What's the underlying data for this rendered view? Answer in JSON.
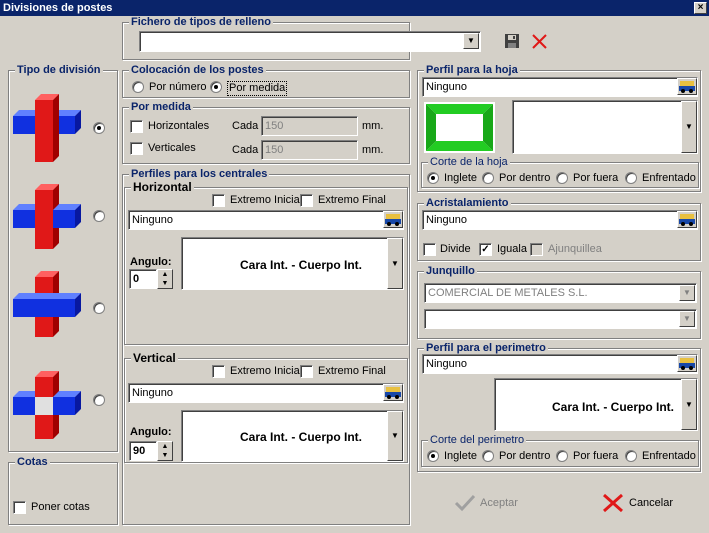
{
  "window": {
    "title": "Divisiones de postes",
    "close_glyph": "×"
  },
  "fichero": {
    "legend": "Fichero de tipos de relleno",
    "value": "",
    "save_icon": "floppy-disk-icon",
    "delete_icon": "red-x-icon"
  },
  "tipo_division": {
    "legend": "Tipo de división",
    "options": [
      {
        "icon": "cross-red-vertical-front-icon",
        "selected": true
      },
      {
        "icon": "cross-red-vertical-icon",
        "selected": false
      },
      {
        "icon": "cross-blue-horizontal-front-icon",
        "selected": false
      },
      {
        "icon": "cross-split-icon",
        "selected": false
      }
    ]
  },
  "cotas": {
    "legend": "Cotas",
    "poner_cotas": "Poner cotas",
    "checked": false
  },
  "colocacion": {
    "legend": "Colocación de los postes",
    "por_numero": "Por número",
    "por_medida": "Por medida",
    "selected": "por_medida"
  },
  "por_medida": {
    "legend": "Por medida",
    "horizontales": {
      "label": "Horizontales",
      "cada": "Cada",
      "value": "150",
      "unit": "mm.",
      "checked": false
    },
    "verticales": {
      "label": "Verticales",
      "cada": "Cada",
      "value": "150",
      "unit": "mm.",
      "checked": false
    }
  },
  "perfiles_centrales": {
    "legend": "Perfiles para los centrales",
    "horizontal": {
      "legend": "Horizontal",
      "extremo_inicial": "Extremo Inicial",
      "extremo_final": "Extremo Final",
      "perfil": "Ninguno",
      "angulo_label": "Angulo:",
      "angulo": "0",
      "cara": "Cara Int. - Cuerpo Int."
    },
    "vertical": {
      "legend": "Vertical",
      "extremo_inicial": "Extremo Inicial",
      "extremo_final": "Extremo Final",
      "perfil": "Ninguno",
      "angulo_label": "Angulo:",
      "angulo": "90",
      "cara": "Cara Int. - Cuerpo Int."
    }
  },
  "perfil_hoja": {
    "legend": "Perfil para la hoja",
    "value": "Ninguno",
    "corte": {
      "legend": "Corte de la hoja",
      "options": [
        "Inglete",
        "Por dentro",
        "Por fuera",
        "Enfrentado"
      ],
      "selected": 0
    }
  },
  "acristalamiento": {
    "legend": "Acristalamiento",
    "value": "Ninguno",
    "divide": "Divide",
    "iguala": "Iguala",
    "ajunquillea": "Ajunquillea",
    "divide_checked": false,
    "iguala_checked": true
  },
  "junquillo": {
    "legend": "Junquillo",
    "value": "COMERCIAL DE METALES S.L.",
    "value2": ""
  },
  "perfil_perimetro": {
    "legend": "Perfil para el perimetro",
    "value": "Ninguno",
    "cara": "Cara Int. - Cuerpo Int.",
    "corte": {
      "legend": "Corte del perimetro",
      "options": [
        "Inglete",
        "Por dentro",
        "Por fuera",
        "Enfrentado"
      ],
      "selected": 0
    }
  },
  "buttons": {
    "aceptar": "Aceptar",
    "cancelar": "Cancelar"
  },
  "colors": {
    "title_bar": "#0a246a",
    "legend_text": "#0a246a",
    "dialog_bg": "#d4d0c8",
    "cross_red": "#e01818",
    "cross_blue": "#1030e0",
    "frame_green": "#22cc22"
  }
}
